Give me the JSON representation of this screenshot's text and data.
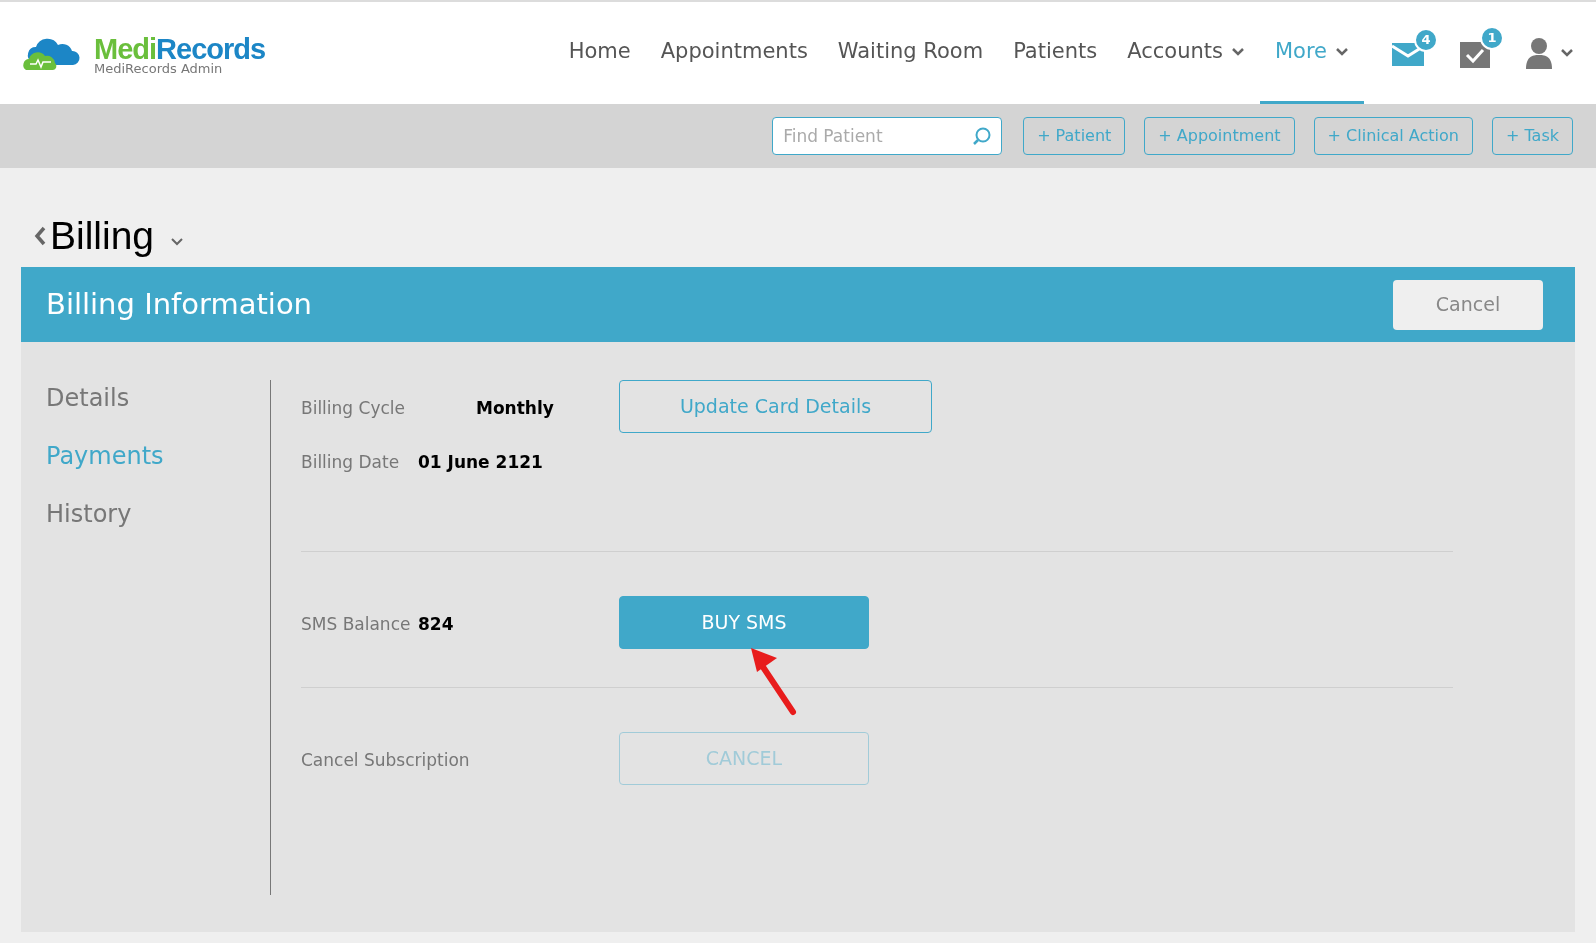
{
  "brand": {
    "name_part1": "Medi",
    "name_part2": "Records",
    "subtitle": "MediRecords Admin"
  },
  "nav": [
    {
      "label": "Home",
      "selected": false,
      "dropdown": false
    },
    {
      "label": "Appointments",
      "selected": false,
      "dropdown": false
    },
    {
      "label": "Waiting Room",
      "selected": false,
      "dropdown": false
    },
    {
      "label": "Patients",
      "selected": false,
      "dropdown": false
    },
    {
      "label": "Accounts",
      "selected": false,
      "dropdown": true
    },
    {
      "label": "More",
      "selected": true,
      "dropdown": true
    }
  ],
  "notifications": [
    {
      "kind": "mail",
      "count": "4"
    },
    {
      "kind": "tasks",
      "count": "1"
    }
  ],
  "toolbar": {
    "search": {
      "placeholder": "Find Patient"
    },
    "buttons": [
      "+ Patient",
      "+ Appointment",
      "+ Clinical Action",
      "+ Task"
    ]
  },
  "page_title": "Billing",
  "panel": {
    "title": "Billing Information",
    "cancel": "Cancel"
  },
  "sidebar": [
    {
      "label": "Details",
      "selected": false
    },
    {
      "label": "Payments",
      "selected": true
    },
    {
      "label": "History",
      "selected": false
    }
  ],
  "sections": [
    {
      "rows": [
        {
          "label": "Billing Cycle",
          "value": "Monthly"
        },
        {
          "label": "Billing Date",
          "value": "01 June 2121"
        }
      ],
      "button": {
        "label": "Update Card Details",
        "kind": "outline",
        "disabled": false
      }
    },
    {
      "rows": [
        {
          "label": "SMS Balance",
          "value": "824"
        }
      ],
      "button": {
        "label": "BUY SMS",
        "kind": "solid",
        "disabled": false
      },
      "annotated": true
    },
    {
      "rows": [
        {
          "label": "Cancel Subscription"
        }
      ],
      "button": {
        "label": "CANCEL",
        "kind": "outline",
        "disabled": true
      }
    }
  ]
}
